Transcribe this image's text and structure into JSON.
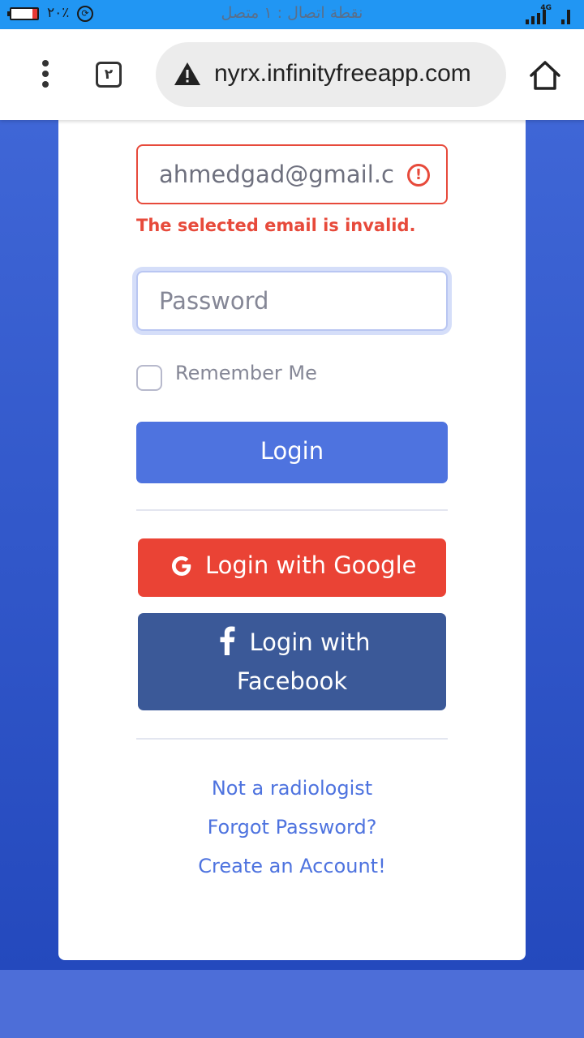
{
  "status_bar": {
    "battery_percent": "٢٠٪",
    "battery_level": 0.2,
    "hotspot_text": "نقطة اتصال : ١ متصل",
    "network_type": "4G",
    "colors": {
      "background": "#2196f3",
      "battery_low": "#e53935"
    }
  },
  "browser": {
    "tab_count": "٢",
    "url": "nyrx.infinityfreeapp.com",
    "icons": {
      "menu": "more-vert-icon",
      "security": "warning-triangle-icon",
      "home": "home-icon"
    }
  },
  "form": {
    "email_value": "ahmedgad@gmail.c",
    "email_error": "The selected email is invalid.",
    "password_placeholder": "Password",
    "remember_me_label": "Remember Me",
    "remember_me_checked": false,
    "login_label": "Login",
    "google_label": "Login with Google",
    "facebook_label": "Login with Facebook",
    "colors": {
      "primary": "#4e73df",
      "danger": "#e74a3b",
      "google": "#ea4335",
      "facebook": "#3b5998"
    }
  },
  "links": {
    "not_radiologist": "Not a radiologist",
    "forgot_password": "Forgot Password?",
    "create_account": "Create an Account!"
  }
}
